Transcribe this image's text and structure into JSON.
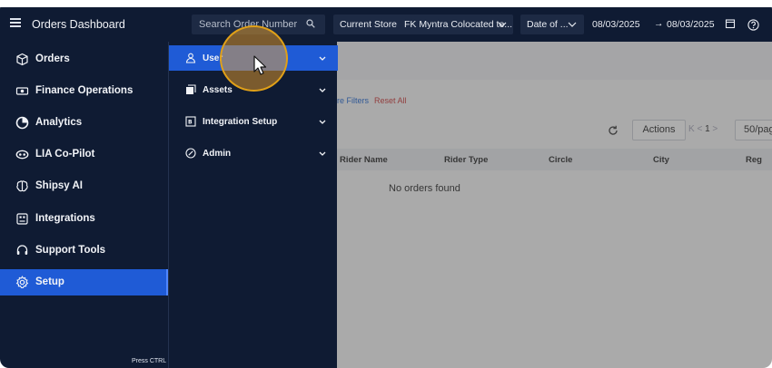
{
  "topbar": {
    "title": "Orders Dashboard",
    "search_placeholder": "Search Order Number",
    "store_label": "Current Store",
    "store_value": "FK Myntra Colocated te...",
    "date_type": "Date of ...",
    "date_from": "08/03/2025",
    "date_to": "08/03/2025",
    "date_arrow": "→"
  },
  "sidebar": {
    "items": [
      {
        "label": "Orders",
        "icon": "box-icon"
      },
      {
        "label": "Finance Operations",
        "icon": "money-icon"
      },
      {
        "label": "Analytics",
        "icon": "pie-chart-icon"
      },
      {
        "label": "LIA Co-Pilot",
        "icon": "copilot-icon"
      },
      {
        "label": "Shipsy AI",
        "icon": "brain-icon"
      },
      {
        "label": "Integrations",
        "icon": "integration-icon"
      },
      {
        "label": "Support Tools",
        "icon": "headset-icon"
      },
      {
        "label": "Setup",
        "icon": "gear-icon",
        "active": true
      }
    ],
    "hint": "Press CTRL + K to search"
  },
  "submenu": {
    "items": [
      {
        "label": "User",
        "icon": "user-icon",
        "active": true
      },
      {
        "label": "Assets",
        "icon": "assets-icon"
      },
      {
        "label": "Integration Setup",
        "icon": "integration-setup-icon"
      },
      {
        "label": "Admin",
        "icon": "shield-icon"
      }
    ]
  },
  "main": {
    "more_filters": "re Filters",
    "reset_all": "Reset All",
    "actions": "Actions",
    "pager_prev": "K  <",
    "pager_current": "1",
    "pager_next": ">",
    "page_size": "50/pag",
    "columns": [
      "Rider Name",
      "Rider Type",
      "Circle",
      "City",
      "Reg"
    ],
    "empty_text": "No orders found"
  },
  "colors": {
    "nav_bg": "#0f1b33",
    "active": "#1f5bd6",
    "highlight": "#e0a018"
  }
}
